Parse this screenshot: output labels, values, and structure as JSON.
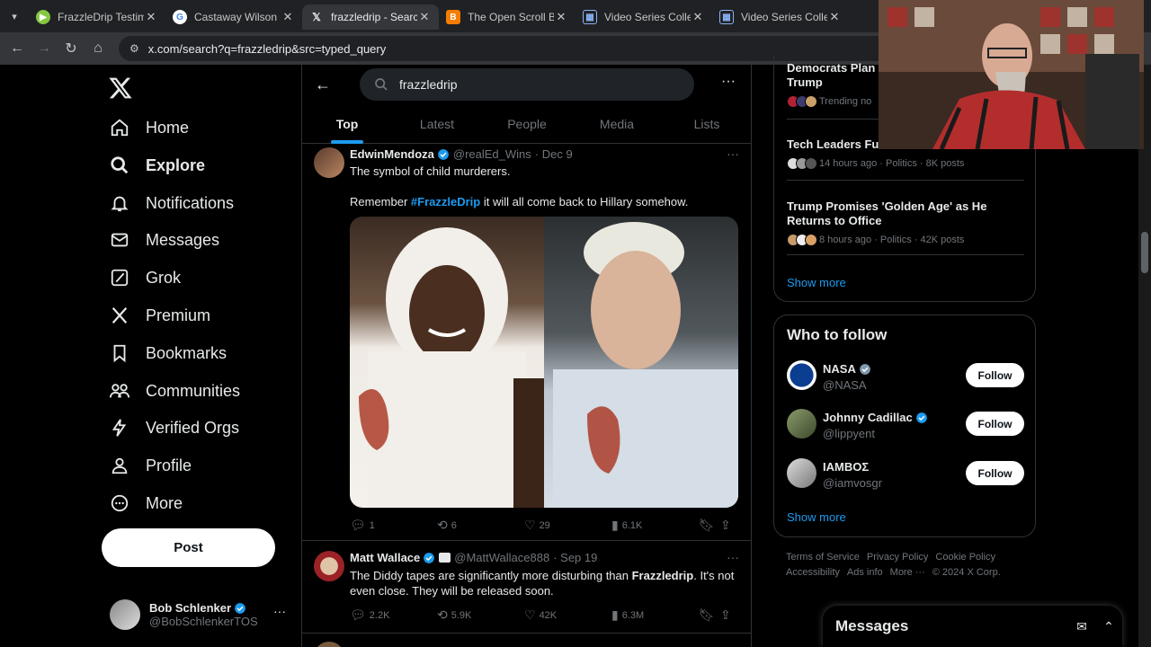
{
  "browser": {
    "tabs": [
      {
        "title": "FrazzleDrip Testimon",
        "icon": "rumble-icon",
        "color": "#85c742",
        "active": false
      },
      {
        "title": "Castaway Wilson - Gr",
        "icon": "google-icon",
        "color": "#ffffff",
        "active": false
      },
      {
        "title": "frazzledrip - Search /",
        "icon": "x-icon",
        "color": "#000000",
        "active": true
      },
      {
        "title": "The Open Scroll Blog",
        "icon": "blogger-icon",
        "color": "#f57d00",
        "active": false
      },
      {
        "title": "Video Series Collecti",
        "icon": "grid-icon",
        "color": "#8ab4f8",
        "active": false
      },
      {
        "title": "Video Series Collecti",
        "icon": "grid-icon",
        "color": "#8ab4f8",
        "active": false
      }
    ],
    "url": "x.com/search?q=frazzledrip&src=typed_query"
  },
  "nav": {
    "items": [
      {
        "label": "Home",
        "icon": "home-icon",
        "bold": false
      },
      {
        "label": "Explore",
        "icon": "search-icon",
        "bold": true
      },
      {
        "label": "Notifications",
        "icon": "bell-icon",
        "bold": false
      },
      {
        "label": "Messages",
        "icon": "mail-icon",
        "bold": false
      },
      {
        "label": "Grok",
        "icon": "grok-icon",
        "bold": false
      },
      {
        "label": "Premium",
        "icon": "x-premium-icon",
        "bold": false
      },
      {
        "label": "Bookmarks",
        "icon": "bookmark-icon",
        "bold": false
      },
      {
        "label": "Communities",
        "icon": "communities-icon",
        "bold": false
      },
      {
        "label": "Verified Orgs",
        "icon": "lightning-icon",
        "bold": false
      },
      {
        "label": "Profile",
        "icon": "person-icon",
        "bold": false
      },
      {
        "label": "More",
        "icon": "more-circle-icon",
        "bold": false
      }
    ],
    "post_label": "Post",
    "account": {
      "name": "Bob Schlenker",
      "handle": "@BobSchlenkerTOS",
      "more": "···"
    }
  },
  "search": {
    "query": "frazzledrip",
    "tabs": [
      "Top",
      "Latest",
      "People",
      "Media",
      "Lists"
    ],
    "selected_tab": "Top"
  },
  "tweets": [
    {
      "name": "EdwinMendoza",
      "handle": "@realEd_Wins",
      "date": "· Dec 9",
      "line1": "The symbol of child murderers.",
      "line2_pre": "Remember ",
      "hashtag": "#FrazzleDrip",
      "line2_post": " it will all come back to Hillary somehow.",
      "replies": "1",
      "reposts": "6",
      "likes": "29",
      "views": "6.1K"
    },
    {
      "name": "Matt Wallace",
      "handle": "@MattWallace888",
      "date": "· Sep 19",
      "text_pre": "The Diddy tapes are significantly more disturbing than ",
      "text_bold": "Frazzledrip",
      "text_post": ". It's not even close. They will be released soon.",
      "replies": "2.2K",
      "reposts": "5.9K",
      "likes": "42K",
      "views": "6.3M"
    }
  ],
  "trends": [
    {
      "title": "Democrats Plan t",
      "title2": "Trump",
      "meta": "Trending no"
    },
    {
      "title": "Tech Leaders Fun",
      "meta": "14 hours ago · Politics · 8K posts"
    },
    {
      "title": "Trump Promises 'Golden Age' as He Returns to Office",
      "meta": "8 hours ago · Politics · 42K posts"
    }
  ],
  "trends_show_more": "Show more",
  "who_to_follow": {
    "title": "Who to follow",
    "accounts": [
      {
        "name": "NASA",
        "handle": "@NASA",
        "verified_color": "#829aab"
      },
      {
        "name": "Johnny Cadillac",
        "handle": "@lippyent",
        "verified_color": "#1d9bf0"
      },
      {
        "name": "ΙΑΜΒΟΣ",
        "handle": "@iamvosgr",
        "verified_color": ""
      }
    ],
    "follow_label": "Follow",
    "show_more": "Show more"
  },
  "footer": {
    "links": [
      "Terms of Service",
      "Privacy Policy",
      "Cookie Policy",
      "Accessibility",
      "Ads info",
      "More ···",
      "© 2024 X Corp."
    ]
  },
  "messages_dock": {
    "title": "Messages"
  },
  "colors": {
    "accent": "#1d9bf0",
    "bg": "#000000",
    "border": "#2f3336",
    "muted": "#71767b"
  }
}
